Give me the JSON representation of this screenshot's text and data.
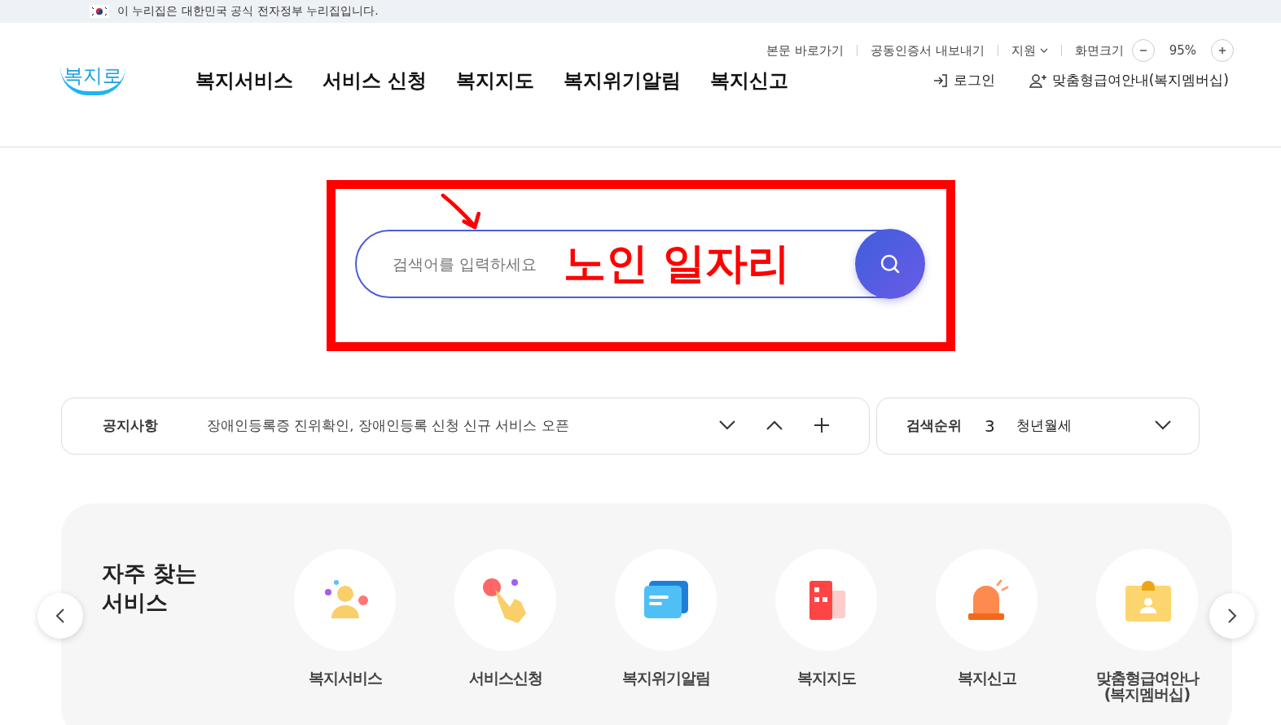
{
  "gov_banner": {
    "text": "이 누리집은 대한민국 공식 전자정부 누리집입니다."
  },
  "utility_links": [
    {
      "label": "본문 바로가기",
      "kind": "link"
    },
    {
      "label": "공동인증서 내보내기",
      "kind": "link"
    },
    {
      "label": "지원",
      "kind": "dropdown"
    }
  ],
  "zoom_control": {
    "label": "화면크기",
    "value": "95%"
  },
  "logo": {
    "text": "복지로"
  },
  "nav": [
    {
      "label": "복지서비스"
    },
    {
      "label": "서비스 신청"
    },
    {
      "label": "복지지도"
    },
    {
      "label": "복지위기알림"
    },
    {
      "label": "복지신고"
    }
  ],
  "account_links": [
    {
      "label": "로그인",
      "kind": "login"
    },
    {
      "label": "맞춤형급여안내(복지멤버십)",
      "kind": "member"
    }
  ],
  "search": {
    "placeholder": "검색어를 입력하세요"
  },
  "annotation": {
    "text": "노인 일자리"
  },
  "notice": {
    "label": "공지사항",
    "text": "장애인등록증 진위확인, 장애인등록 신청 신규 서비스 오픈"
  },
  "ranking": {
    "label": "검색순위",
    "rank": "3",
    "term": "청년월세"
  },
  "frequent": {
    "title": "자주 찾는\n서비스",
    "items": [
      {
        "label": "복지서비스",
        "kind": "person"
      },
      {
        "label": "서비스신청",
        "kind": "hand"
      },
      {
        "label": "복지위기알림",
        "kind": "message"
      },
      {
        "label": "복지지도",
        "kind": "building"
      },
      {
        "label": "복지신고",
        "kind": "siren"
      },
      {
        "label": "맞춤형급여안나\n(복지멤버십)",
        "kind": "badge"
      }
    ]
  }
}
